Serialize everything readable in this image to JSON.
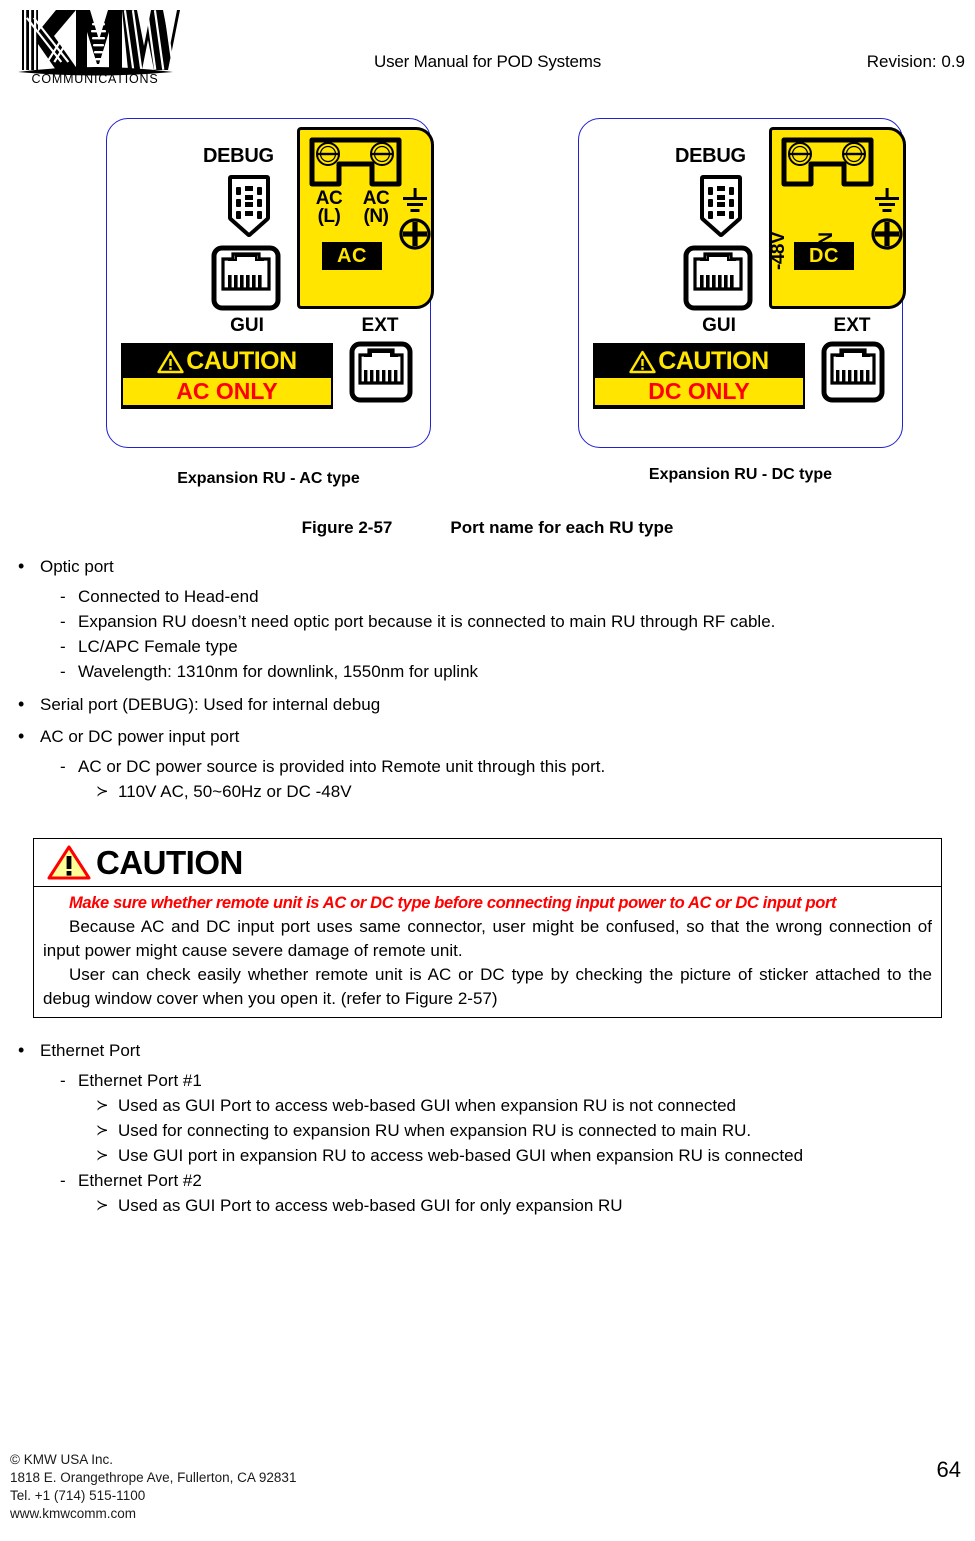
{
  "header": {
    "logo_main": "KMW",
    "logo_sub": "COMMUNICATIONS",
    "title": "User Manual for POD Systems",
    "revision": "Revision: 0.9"
  },
  "figure": {
    "left_panel": {
      "debug_label": "DEBUG",
      "gui_label": "GUI",
      "ext_label": "EXT",
      "terminal_label_1": "AC\n(L)",
      "terminal_label_1_line1": "AC",
      "terminal_label_1_line2": "(L)",
      "terminal_label_2_line1": "AC",
      "terminal_label_2_line2": "(N)",
      "type_tag": "AC",
      "sticker_caution": "CAUTION",
      "sticker_only": "AC ONLY"
    },
    "right_panel": {
      "debug_label": "DEBUG",
      "gui_label": "GUI",
      "ext_label": "EXT",
      "terminal_label_1": "-48V",
      "terminal_label_2": "RTN",
      "type_tag": "DC",
      "sticker_caution": "CAUTION",
      "sticker_only": "DC ONLY"
    },
    "subcaption_left": "Expansion RU - AC type",
    "subcaption_right": "Expansion RU - DC type",
    "caption_number": "Figure 2-57",
    "caption_text": "Port name for each RU type",
    "colors": {
      "panel_border": "#2222cc",
      "yellow": "#ffe500",
      "red": "#ff0000",
      "black": "#000000"
    }
  },
  "body": {
    "optic_port": {
      "heading": "Optic port",
      "items": [
        "Connected to Head-end",
        "Expansion RU doesn’t need optic port because it is connected to main RU through RF cable.",
        "LC/APC Female type",
        "Wavelength: 1310nm for downlink, 1550nm for uplink"
      ]
    },
    "serial_port": {
      "heading": "Serial port (DEBUG): Used for internal debug"
    },
    "power_port": {
      "heading": "AC or DC power input port",
      "item": "AC or DC power source is provided into Remote unit through this port.",
      "subitem": "110V AC, 50~60Hz or DC -48V"
    },
    "ethernet": {
      "heading": "Ethernet Port",
      "port1_label": "Ethernet Port #1",
      "port1_items": [
        "Used as GUI Port to access web-based GUI when expansion RU is not connected",
        "Used for connecting to expansion RU when expansion RU is connected to main RU.",
        "Use GUI port in expansion RU to access web-based GUI when expansion RU is connected"
      ],
      "port2_label": "Ethernet Port #2",
      "port2_items": [
        "Used as GUI Port to access web-based GUI for only expansion RU"
      ]
    }
  },
  "caution_box": {
    "title": "CAUTION",
    "warning_line": "Make sure whether remote unit is AC or DC type before connecting input power to AC or DC input port",
    "paragraph_1": "Because AC and DC input port uses same connector, user might be confused, so that the wrong connection of input power might cause severe damage of remote unit.",
    "paragraph_2": "User can check easily whether remote unit is AC or DC type by checking the picture of sticker attached to the debug window cover when you open it. (refer to Figure 2-57)"
  },
  "footer": {
    "line1": "© KMW USA Inc.",
    "line2": "1818 E. Orangethrope Ave, Fullerton, CA 92831",
    "line3": "Tel. +1 (714) 515-1100",
    "line4": "www.kmwcomm.com",
    "page_number": "64"
  }
}
